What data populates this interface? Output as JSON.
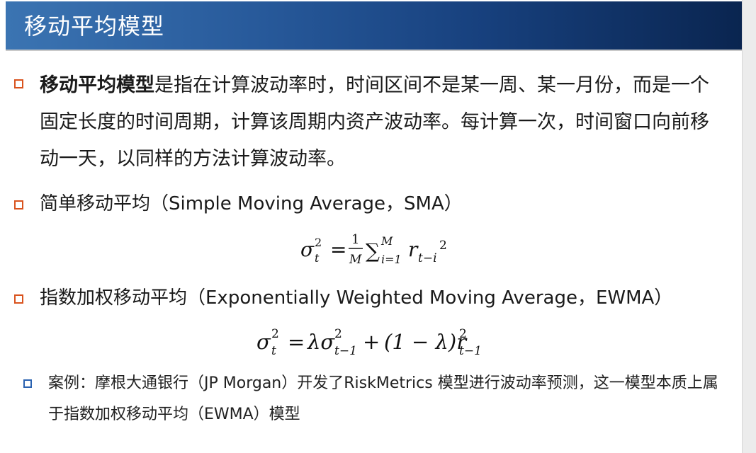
{
  "header": {
    "title": "移动平均模型"
  },
  "bullets": {
    "b1_bold": "移动平均模型",
    "b1_text": "是指在计算波动率时，时间区间不是某一周、某一月份，而是一个固定长度的时间周期，计算该周期内资产波动率。每计算一次，时间窗口向前移动一天，以同样的方法计算波动率。",
    "b2_text": "简单移动平均（Simple Moving Average，SMA）",
    "b3_text": "指数加权移动平均（Exponentially Weighted Moving Average，EWMA）",
    "b4_text": "案例：摩根大通银行（JP Morgan）开发了RiskMetrics 模型进行波动率预测，这一模型本质上属于指数加权移动平均（EWMA）模型"
  },
  "formulas": {
    "sma": {
      "sigma": "σ",
      "sup2": "2",
      "sub_t": "t",
      "equals": "=",
      "num": "1",
      "den": "M",
      "sum": "∑",
      "upper": "M",
      "lower": "i=1",
      "r": "r",
      "sub_r": "t−i",
      "sup_r": "2"
    },
    "ewma": {
      "sigma": "σ",
      "sup2": "2",
      "sub_t": "t",
      "equals": "=",
      "lambda_sigma": "λσ",
      "sup2b": "2",
      "sub_t1": "t−1",
      "plus": "+",
      "paren": "(1 − λ)r",
      "sup2c": "2",
      "sub_t1b": "t−1"
    }
  }
}
